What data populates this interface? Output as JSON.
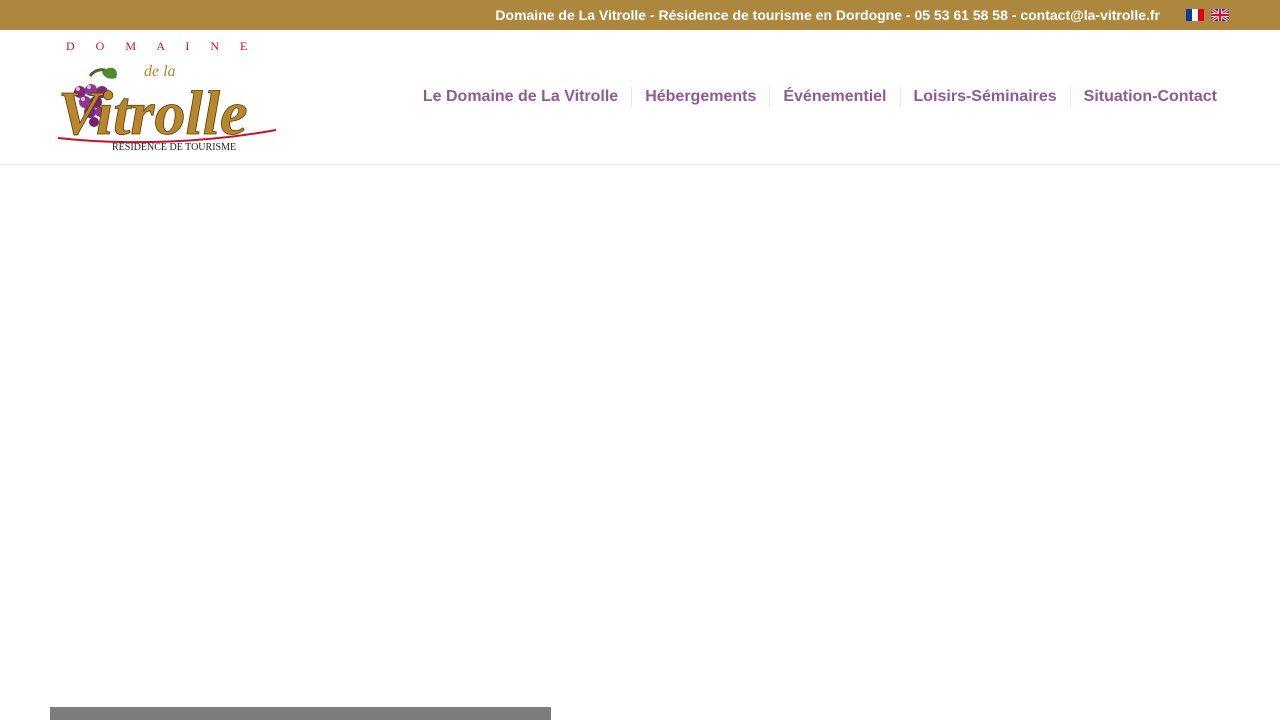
{
  "topbar": {
    "info_text": "Domaine de La Vitrolle - Résidence de tourisme en Dordogne - 05 53 61 58 58 - contact@la-vitrolle.fr",
    "languages": [
      {
        "icon": "flag-fr-icon"
      },
      {
        "icon": "flag-uk-icon"
      }
    ]
  },
  "logo": {
    "top_word": "D O M A I N E",
    "small_word": "de la",
    "main_word": "Vitrolle",
    "tagline": "RÉSIDENCE DE TOURISME"
  },
  "nav": {
    "items": [
      {
        "label": "Le Domaine de La Vitrolle"
      },
      {
        "label": "Hébergements"
      },
      {
        "label": "Événementiel"
      },
      {
        "label": "Loisirs-Séminaires"
      },
      {
        "label": "Situation-Contact"
      }
    ]
  },
  "colors": {
    "topbar": "#ad873e",
    "nav_text": "#8f5a98",
    "logo_red": "#c8102e",
    "logo_gold": "#b8862b",
    "grape": "#7b2d7b"
  }
}
